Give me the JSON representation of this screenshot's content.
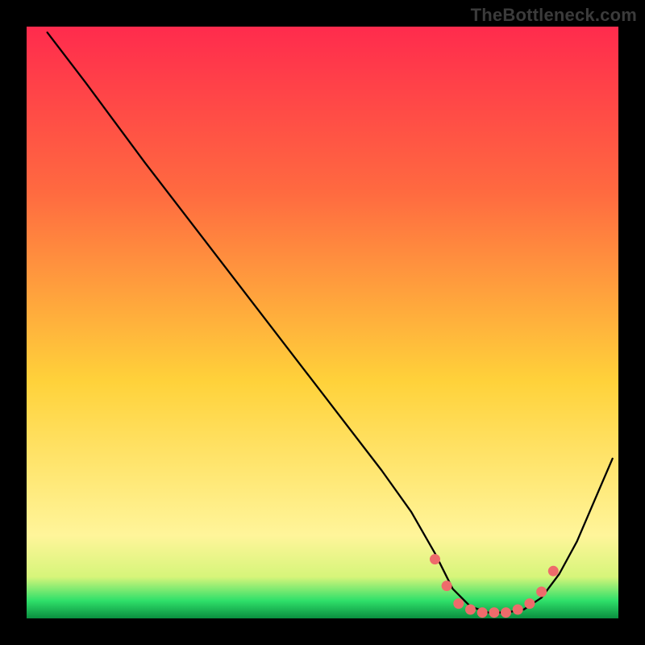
{
  "watermark": "TheBottleneck.com",
  "colors": {
    "frame": "#000000",
    "watermark": "#3b3b3b",
    "curve": "#000000",
    "dots": "#ee6b6b",
    "gradient_top": "#ff2b4d",
    "gradient_mid1": "#ff6a40",
    "gradient_mid2": "#ffd23a",
    "gradient_band_yellow": "#fff59a",
    "gradient_band_green": "#2fe06a",
    "gradient_bottom": "#0a8f3f"
  },
  "chart_data": {
    "type": "line",
    "title": "",
    "xlabel": "",
    "ylabel": "",
    "xlim": [
      0,
      100
    ],
    "ylim": [
      0,
      100
    ],
    "grid": false,
    "legend": false,
    "note": "Axis values are not labeled in the source image; x/y are inferred as normalized 0–100 coordinates read from pixel positions inside the plot frame. The curve shows a bottleneck profile: high on the left, descending to a flat minimum around x≈72–85, then rising toward the right edge.",
    "series": [
      {
        "name": "bottleneck-curve",
        "x": [
          3.5,
          10,
          20,
          30,
          40,
          50,
          60,
          65,
          69,
          72,
          75,
          78,
          81,
          84,
          87,
          90,
          93,
          96,
          99
        ],
        "y": [
          99,
          90.5,
          77,
          64,
          51,
          38,
          25,
          18,
          11,
          5,
          2,
          1,
          1,
          1.5,
          3.5,
          7.5,
          13,
          20,
          27
        ]
      }
    ],
    "dots": {
      "name": "marker-dots",
      "note": "Coral dots clustered around the trough of the curve.",
      "x": [
        69,
        71,
        73,
        75,
        77,
        79,
        81,
        83,
        85,
        87,
        89
      ],
      "y": [
        10,
        5.5,
        2.5,
        1.5,
        1,
        1,
        1,
        1.5,
        2.5,
        4.5,
        8
      ]
    }
  }
}
